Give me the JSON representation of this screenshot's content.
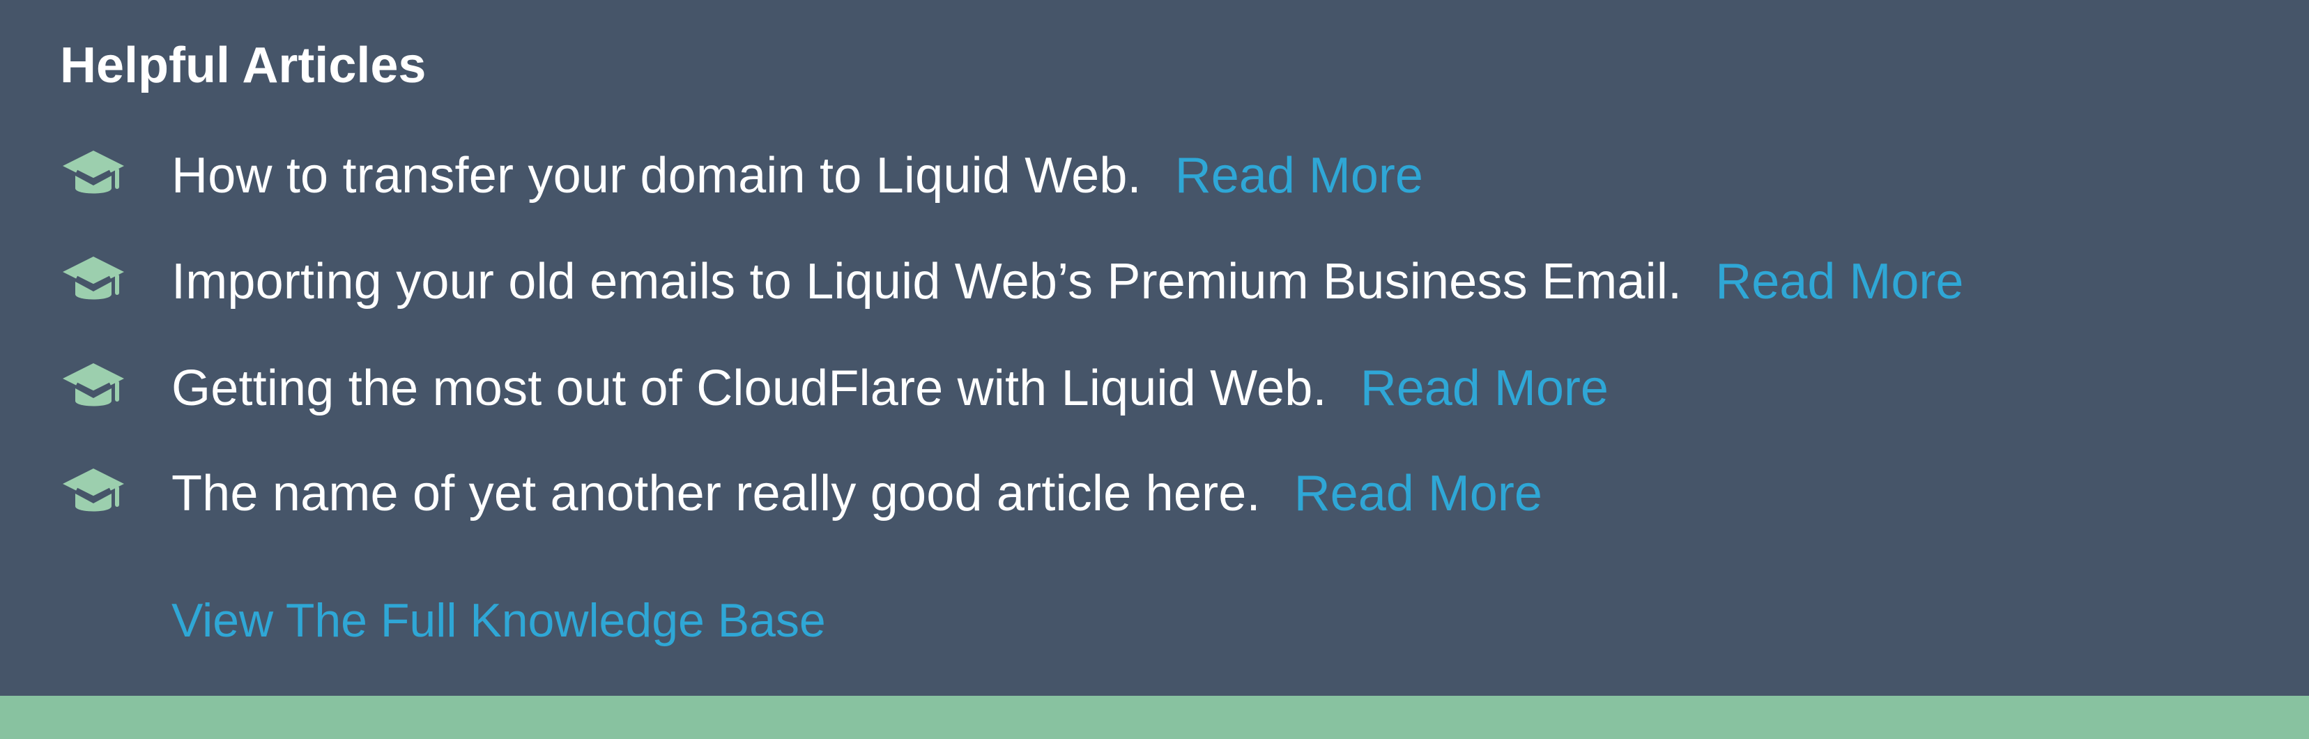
{
  "colors": {
    "panel_background": "#465569",
    "text": "#ffffff",
    "link": "#2fa7d6",
    "icon": "#9ccfae",
    "footer_band": "#88c2a0"
  },
  "articles": {
    "heading": "Helpful Articles",
    "items": [
      {
        "icon": "graduation-cap-icon",
        "title": "How to transfer your domain to Liquid Web.",
        "link_label": "Read More"
      },
      {
        "icon": "graduation-cap-icon",
        "title": "Importing your old emails to Liquid Web’s Premium Business Email.",
        "link_label": "Read More"
      },
      {
        "icon": "graduation-cap-icon",
        "title": "Getting the most out of CloudFlare with Liquid Web.",
        "link_label": "Read More"
      },
      {
        "icon": "graduation-cap-icon",
        "title": "The name of yet another really good article here.",
        "link_label": "Read More"
      }
    ],
    "knowledge_base_link": "View The Full Knowledge Base"
  }
}
